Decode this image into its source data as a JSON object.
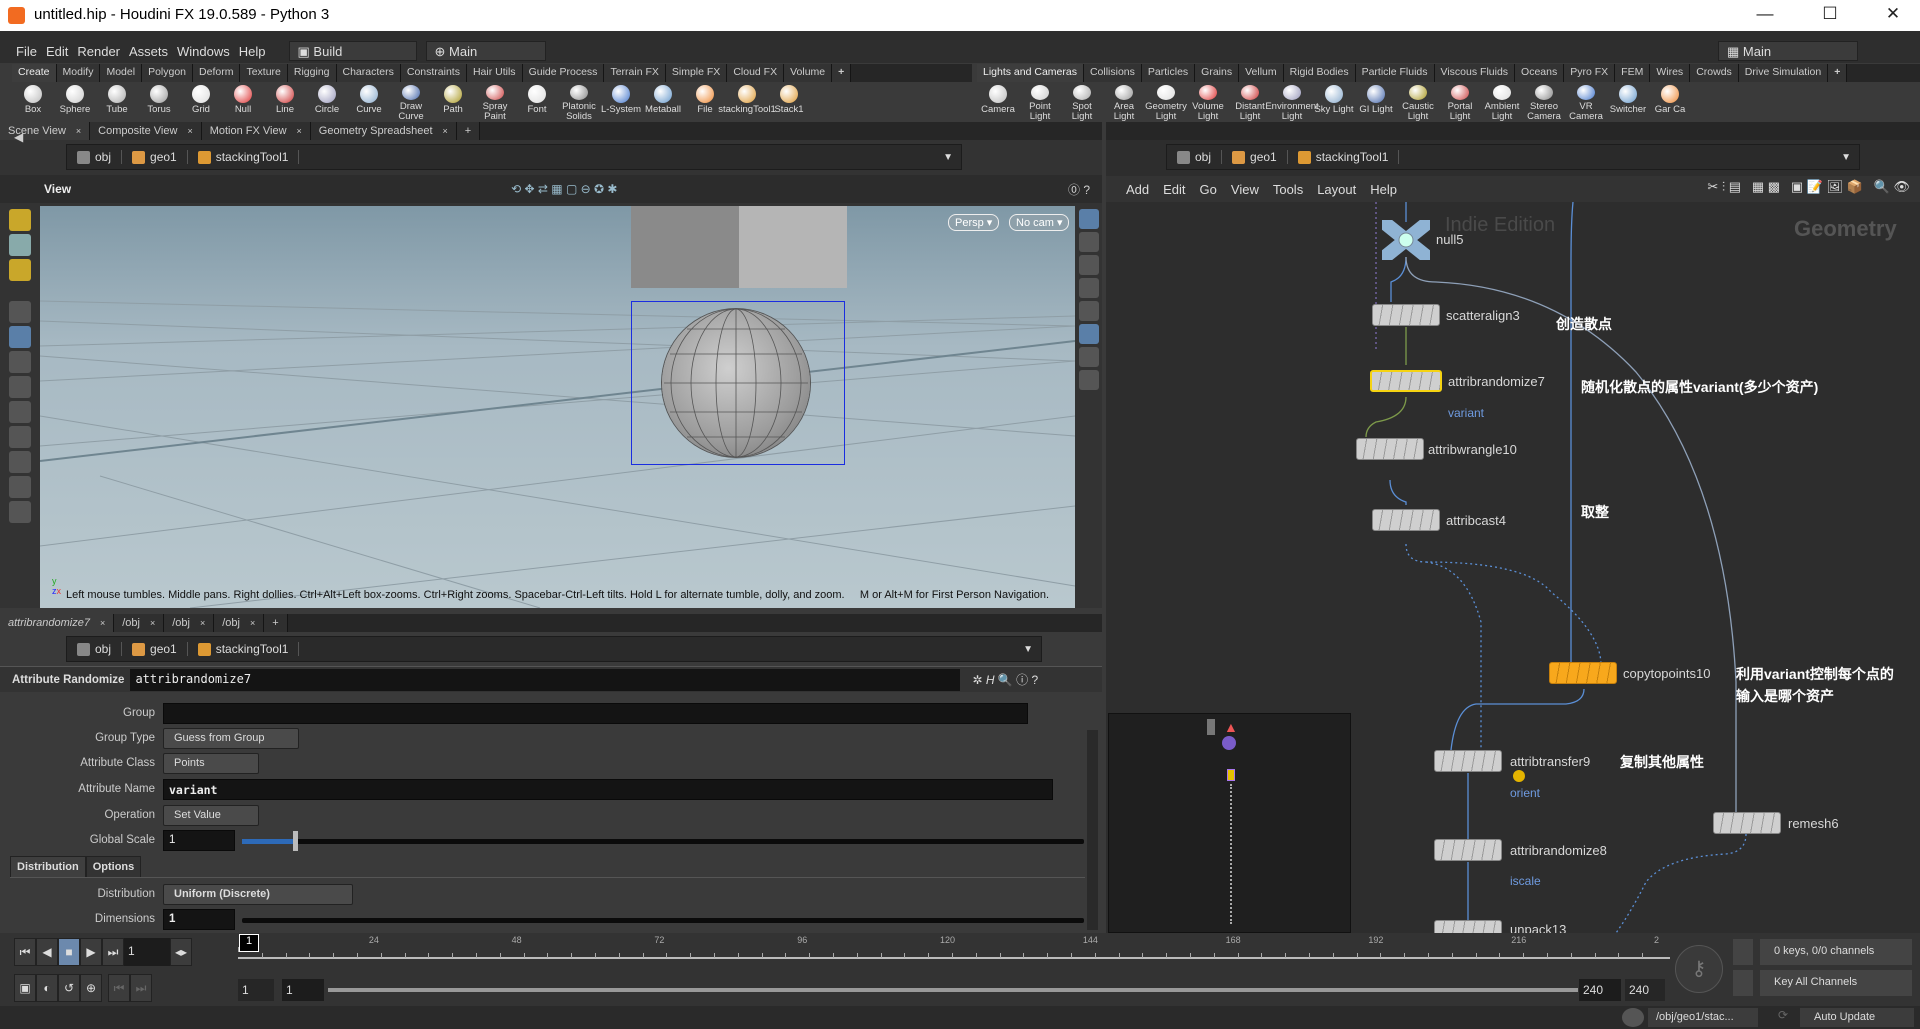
{
  "window": {
    "title": "untitled.hip - Houdini FX 19.0.589 - Python 3",
    "minimize": "—",
    "maximize": "☐",
    "close": "✕"
  },
  "menu": {
    "items": [
      "File",
      "Edit",
      "Render",
      "Assets",
      "Windows",
      "Help"
    ],
    "desktop": "Build",
    "context": "Main",
    "right_context": "Main"
  },
  "shelf_left": {
    "tabs": [
      "Create",
      "Modify",
      "Model",
      "Polygon",
      "Deform",
      "Texture",
      "Rigging",
      "Characters",
      "Constraints",
      "Hair Utils",
      "Guide Process",
      "Terrain FX",
      "Simple FX",
      "Cloud FX",
      "Volume"
    ],
    "active": "Create",
    "tools": [
      "Box",
      "Sphere",
      "Tube",
      "Torus",
      "Grid",
      "Null",
      "Line",
      "Circle",
      "Curve",
      "Draw Curve",
      "Path",
      "Spray Paint",
      "Font",
      "Platonic Solids",
      "L-System",
      "Metaball",
      "File",
      "stackingTool1",
      "Stack1"
    ]
  },
  "shelf_right": {
    "tabs": [
      "Lights and Cameras",
      "Collisions",
      "Particles",
      "Grains",
      "Vellum",
      "Rigid Bodies",
      "Particle Fluids",
      "Viscous Fluids",
      "Oceans",
      "Pyro FX",
      "FEM",
      "Wires",
      "Crowds",
      "Drive Simulation"
    ],
    "active": "Lights and Cameras",
    "tools": [
      "Camera",
      "Point Light",
      "Spot Light",
      "Area Light",
      "Geometry Light",
      "Volume Light",
      "Distant Light",
      "Environment Light",
      "Sky Light",
      "GI Light",
      "Caustic Light",
      "Portal Light",
      "Ambient Light",
      "Stereo Camera",
      "VR Camera",
      "Switcher",
      "Gar Ca"
    ]
  },
  "scene_pane": {
    "tabs": [
      "Scene View",
      "Composite View",
      "Motion FX View",
      "Geometry Spreadsheet"
    ],
    "path": [
      "obj",
      "geo1",
      "stackingTool1"
    ],
    "view_label": "View",
    "persp": "Persp ▾",
    "cam": "No cam ▾",
    "help": "Left mouse tumbles. Middle pans. Right dollies. Ctrl+Alt+Left box-zooms. Ctrl+Right zooms. Spacebar-Ctrl-Left tilts. Hold L for alternate tumble, dolly, and zoom.     M or Alt+M for First Person Navigation."
  },
  "param_pane": {
    "tabs": [
      "attribrandomize7",
      "/obj",
      "/obj",
      "/obj"
    ],
    "path": [
      "obj",
      "geo1",
      "stackingTool1"
    ],
    "node_type": "Attribute Randomize",
    "node_name": "attribrandomize7",
    "params": {
      "group_label": "Group",
      "group_value": "",
      "group_type_label": "Group Type",
      "group_type": "Guess from Group",
      "attr_class_label": "Attribute Class",
      "attr_class": "Points",
      "attr_name_label": "Attribute Name",
      "attr_name": "variant",
      "operation_label": "Operation",
      "operation": "Set Value",
      "global_scale_label": "Global Scale",
      "global_scale": "1",
      "global_scale_fraction": 0.06,
      "subtabs": [
        "Distribution",
        "Options"
      ],
      "distribution_label": "Distribution",
      "distribution": "Uniform (Discrete)",
      "dimensions_label": "Dimensions",
      "dimensions": "1"
    }
  },
  "network": {
    "path": [
      "obj",
      "geo1",
      "stackingTool1"
    ],
    "menu": [
      "Add",
      "Edit",
      "Go",
      "View",
      "Tools",
      "Layout",
      "Help"
    ],
    "watermark": "Indie Edition",
    "context_label": "Geometry",
    "nodes": [
      {
        "name": "null5",
        "type": "null"
      },
      {
        "name": "scatteralign3",
        "flag": ""
      },
      {
        "name": "attribrandomize7",
        "flag": "variant",
        "selected": true
      },
      {
        "name": "attribwrangle10",
        "flag": ""
      },
      {
        "name": "attribcast4",
        "flag": ""
      },
      {
        "name": "copytopoints10",
        "flag": "",
        "display": true
      },
      {
        "name": "attribtransfer9",
        "flag": "orient",
        "warning": true
      },
      {
        "name": "attribrandomize8",
        "flag": "iscale"
      },
      {
        "name": "unpack13",
        "flag": ""
      },
      {
        "name": "remesh6",
        "flag": ""
      }
    ],
    "notes": [
      "创造散点",
      "随机化散点的属性variant(多少个资产)",
      "取整",
      "利用variant控制每个点的",
      "输入是哪个资产",
      "复制其他属性"
    ]
  },
  "timeline": {
    "current_frame": "1",
    "frame_marker": "1",
    "ticks": [
      "24",
      "48",
      "72",
      "96",
      "120",
      "144",
      "168",
      "192",
      "216",
      "2"
    ],
    "range_start": "1",
    "range_start2": "1",
    "range_end": "240",
    "range_end2": "240",
    "keys": "0 keys, 0/0 channels",
    "key_all": "Key All Channels"
  },
  "status": {
    "path": "/obj/geo1/stac...",
    "update": "Auto Update"
  },
  "colors": {
    "accent": "#f8a81c",
    "selected": "#f5d312",
    "wire": "#5b8fd6",
    "bg": "#2d2d2d"
  }
}
